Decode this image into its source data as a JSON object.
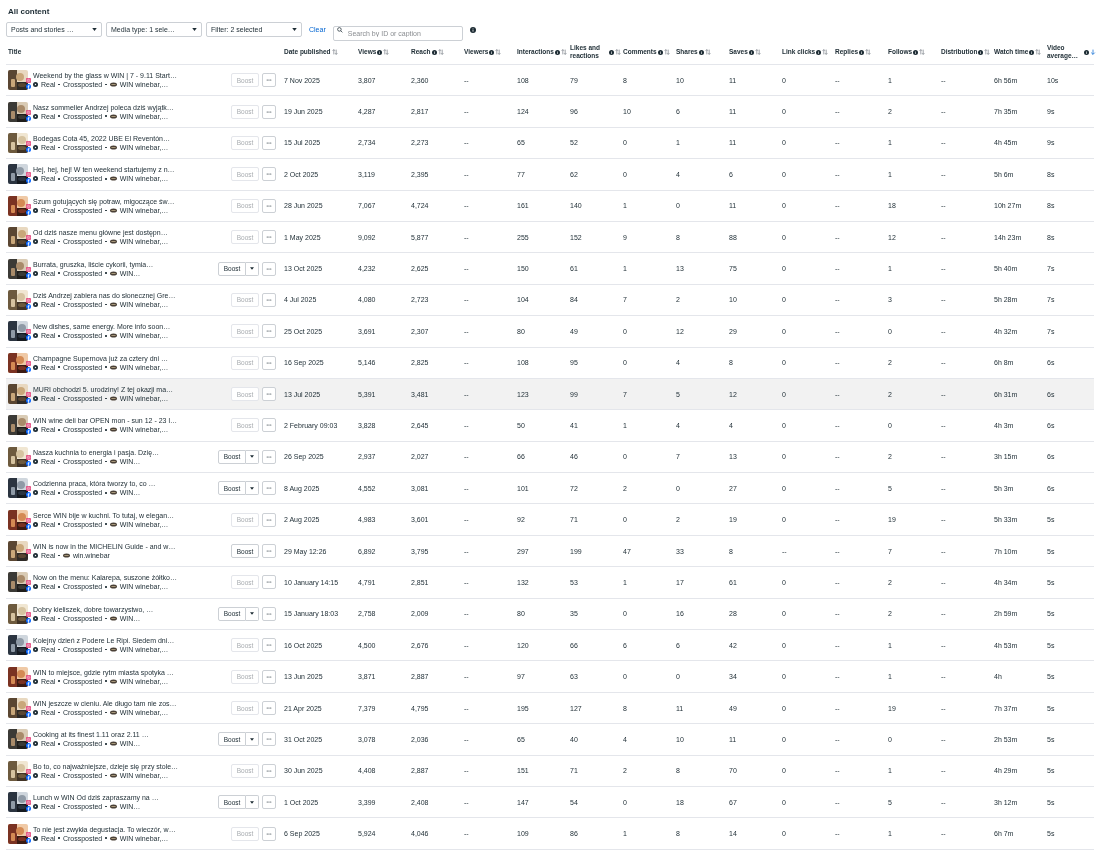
{
  "title": "All content",
  "filters": [
    {
      "label": "Posts and stories …"
    },
    {
      "label": "Media type: 1 sele…"
    },
    {
      "label": "Filter: 2 selected"
    }
  ],
  "clear_link": "Clear",
  "search": {
    "placeholder": "Search by ID or caption"
  },
  "columns": [
    {
      "label": "Title",
      "info": false,
      "sortable": false
    },
    {
      "label": "Date published",
      "info": false,
      "sortable": true,
      "sorted_descending": false
    },
    {
      "label": "Views",
      "info": true,
      "sortable": true,
      "sorted_descending": false
    },
    {
      "label": "Reach",
      "info": true,
      "sortable": true,
      "sorted_descending": false
    },
    {
      "label": "Viewers",
      "info": true,
      "sortable": true,
      "sorted_descending": false
    },
    {
      "label": "Interactions",
      "info": true,
      "sortable": true,
      "sorted_descending": false
    },
    {
      "label": "Likes and reactions",
      "info": true,
      "sortable": true,
      "sorted_descending": false
    },
    {
      "label": "Comments",
      "info": true,
      "sortable": true,
      "sorted_descending": false
    },
    {
      "label": "Shares",
      "info": true,
      "sortable": true,
      "sorted_descending": false
    },
    {
      "label": "Saves",
      "info": true,
      "sortable": true,
      "sorted_descending": false
    },
    {
      "label": "Link clicks",
      "info": true,
      "sortable": true,
      "sorted_descending": false
    },
    {
      "label": "Replies",
      "info": true,
      "sortable": true,
      "sorted_descending": false
    },
    {
      "label": "Follows",
      "info": true,
      "sortable": true,
      "sorted_descending": false
    },
    {
      "label": "Distribution",
      "info": true,
      "sortable": true,
      "sorted_descending": false
    },
    {
      "label": "Watch time",
      "info": true,
      "sortable": true,
      "sorted_descending": false
    },
    {
      "label": "Video average…",
      "info": true,
      "sortable": true,
      "sorted_descending": true
    }
  ],
  "rows": [
    {
      "title": "Weekend by the glass w WIN | 7 - 9.11 Start…",
      "type": "Real",
      "crossposted": "Crossposted",
      "account": "WIN winebar,…",
      "facebook": true,
      "boost_enabled": false,
      "boost_split": false,
      "boost_label": "Boost",
      "selected": false,
      "cells": [
        "7 Nov 2025",
        "3,807",
        "2,360",
        "--",
        "108",
        "79",
        "8",
        "10",
        "11",
        "0",
        "--",
        "1",
        "--",
        "6h 56m",
        "10s"
      ]
    },
    {
      "title": "Nasz sommelier Andrzej poleca dziś wyjątk…",
      "type": "Real",
      "crossposted": "Crossposted",
      "account": "WIN winebar,…",
      "facebook": true,
      "boost_enabled": false,
      "boost_split": false,
      "boost_label": "Boost",
      "selected": false,
      "cells": [
        "19 Jun 2025",
        "4,287",
        "2,817",
        "--",
        "124",
        "96",
        "10",
        "6",
        "11",
        "0",
        "--",
        "2",
        "--",
        "7h 35m",
        "9s"
      ]
    },
    {
      "title": "Bodegas Cota 45, 2022 UBE El Reventón…",
      "type": "Real",
      "crossposted": "Crossposted",
      "account": "WIN winebar,…",
      "facebook": true,
      "boost_enabled": false,
      "boost_split": false,
      "boost_label": "Boost",
      "selected": false,
      "cells": [
        "15 Jul 2025",
        "2,734",
        "2,273",
        "--",
        "65",
        "52",
        "0",
        "1",
        "11",
        "0",
        "--",
        "1",
        "--",
        "4h 45m",
        "9s"
      ]
    },
    {
      "title": "Hej, hej, hej! W ten weekend startujemy z n…",
      "type": "Real",
      "crossposted": "Crossposted",
      "account": "WIN winebar,…",
      "facebook": true,
      "boost_enabled": false,
      "boost_split": false,
      "boost_label": "Boost",
      "selected": false,
      "cells": [
        "2 Oct 2025",
        "3,119",
        "2,395",
        "--",
        "77",
        "62",
        "0",
        "4",
        "6",
        "0",
        "--",
        "1",
        "--",
        "5h 6m",
        "8s"
      ]
    },
    {
      "title": "Szum gotujących się potraw, migoczące św…",
      "type": "Real",
      "crossposted": "Crossposted",
      "account": "WIN winebar,…",
      "facebook": true,
      "boost_enabled": false,
      "boost_split": false,
      "boost_label": "Boost",
      "selected": false,
      "cells": [
        "28 Jun 2025",
        "7,067",
        "4,724",
        "--",
        "161",
        "140",
        "1",
        "0",
        "11",
        "0",
        "--",
        "18",
        "--",
        "10h 27m",
        "8s"
      ]
    },
    {
      "title": "Od dziś nasze menu główne jest dostępn…",
      "type": "Real",
      "crossposted": "Crossposted",
      "account": "WIN winebar,…",
      "facebook": true,
      "boost_enabled": false,
      "boost_split": false,
      "boost_label": "Boost",
      "selected": false,
      "cells": [
        "1 May 2025",
        "9,092",
        "5,877",
        "--",
        "255",
        "152",
        "9",
        "8",
        "88",
        "0",
        "--",
        "12",
        "--",
        "14h 23m",
        "8s"
      ]
    },
    {
      "title": "Burrata, gruszka, liście cykorii, tymia…",
      "type": "Real",
      "crossposted": "Crossposted",
      "account": "WIN…",
      "facebook": true,
      "boost_enabled": true,
      "boost_split": true,
      "boost_label": "Boost",
      "selected": false,
      "cells": [
        "13 Oct 2025",
        "4,232",
        "2,625",
        "--",
        "150",
        "61",
        "1",
        "13",
        "75",
        "0",
        "--",
        "1",
        "--",
        "5h 40m",
        "7s"
      ]
    },
    {
      "title": "Dziś Andrzej zabiera nas do słonecznej Gre…",
      "type": "Real",
      "crossposted": "Crossposted",
      "account": "WIN winebar,…",
      "facebook": true,
      "boost_enabled": false,
      "boost_split": false,
      "boost_label": "Boost",
      "selected": false,
      "cells": [
        "4 Jul 2025",
        "4,080",
        "2,723",
        "--",
        "104",
        "84",
        "7",
        "2",
        "10",
        "0",
        "--",
        "3",
        "--",
        "5h 28m",
        "7s"
      ]
    },
    {
      "title": "New dishes, same energy. More info soon…",
      "type": "Real",
      "crossposted": "Crossposted",
      "account": "WIN winebar,…",
      "facebook": true,
      "boost_enabled": false,
      "boost_split": false,
      "boost_label": "Boost",
      "selected": false,
      "cells": [
        "25 Oct 2025",
        "3,691",
        "2,307",
        "--",
        "80",
        "49",
        "0",
        "12",
        "29",
        "0",
        "--",
        "0",
        "--",
        "4h 32m",
        "7s"
      ]
    },
    {
      "title": "Champagne Supernova już za cztery dni …",
      "type": "Real",
      "crossposted": "Crossposted",
      "account": "WIN winebar,…",
      "facebook": true,
      "boost_enabled": false,
      "boost_split": false,
      "boost_label": "Boost",
      "selected": false,
      "cells": [
        "16 Sep 2025",
        "5,146",
        "2,825",
        "--",
        "108",
        "95",
        "0",
        "4",
        "8",
        "0",
        "--",
        "2",
        "--",
        "6h 8m",
        "6s"
      ]
    },
    {
      "title": "MURI obchodzi 5. urodziny! Z tej okazji ma…",
      "type": "Real",
      "crossposted": "Crossposted",
      "account": "WIN winebar,…",
      "facebook": true,
      "boost_enabled": false,
      "boost_split": false,
      "boost_label": "Boost",
      "selected": true,
      "cells": [
        "13 Jul 2025",
        "5,391",
        "3,481",
        "--",
        "123",
        "99",
        "7",
        "5",
        "12",
        "0",
        "--",
        "2",
        "--",
        "6h 31m",
        "6s"
      ]
    },
    {
      "title": "WIN wine deli bar OPEN mon - sun 12 - 23 l…",
      "type": "Real",
      "crossposted": "Crossposted",
      "account": "WIN winebar,…",
      "facebook": true,
      "boost_enabled": false,
      "boost_split": false,
      "boost_label": "Boost",
      "selected": false,
      "cells": [
        "2 February 09:03",
        "3,828",
        "2,645",
        "--",
        "50",
        "41",
        "1",
        "4",
        "4",
        "0",
        "--",
        "0",
        "--",
        "4h 3m",
        "6s"
      ]
    },
    {
      "title": "Nasza kuchnia to energia i pasja. Dzię…",
      "type": "Real",
      "crossposted": "Crossposted",
      "account": "WIN…",
      "facebook": true,
      "boost_enabled": true,
      "boost_split": true,
      "boost_label": "Boost",
      "selected": false,
      "cells": [
        "26 Sep 2025",
        "2,937",
        "2,027",
        "--",
        "66",
        "46",
        "0",
        "7",
        "13",
        "0",
        "--",
        "2",
        "--",
        "3h 15m",
        "6s"
      ]
    },
    {
      "title": "Codzienna praca, która tworzy to, co …",
      "type": "Real",
      "crossposted": "Crossposted",
      "account": "WIN…",
      "facebook": true,
      "boost_enabled": true,
      "boost_split": true,
      "boost_label": "Boost",
      "selected": false,
      "cells": [
        "8 Aug 2025",
        "4,552",
        "3,081",
        "--",
        "101",
        "72",
        "2",
        "0",
        "27",
        "0",
        "--",
        "5",
        "--",
        "5h 3m",
        "6s"
      ]
    },
    {
      "title": "Serce WIN bije w kuchni. To tutaj, w elegan…",
      "type": "Real",
      "crossposted": "Crossposted",
      "account": "WIN winebar,…",
      "facebook": true,
      "boost_enabled": false,
      "boost_split": false,
      "boost_label": "Boost",
      "selected": false,
      "cells": [
        "2 Aug 2025",
        "4,983",
        "3,601",
        "--",
        "92",
        "71",
        "0",
        "2",
        "19",
        "0",
        "--",
        "19",
        "--",
        "5h 33m",
        "5s"
      ]
    },
    {
      "title": "WIN is now in the MICHELIN Guide - and w…",
      "type": "Real",
      "account": "win.winebar",
      "facebook": false,
      "boost_enabled": true,
      "boost_split": false,
      "boost_label": "Boost",
      "selected": false,
      "cells": [
        "29 May 12:26",
        "6,892",
        "3,795",
        "--",
        "297",
        "199",
        "47",
        "33",
        "8",
        "--",
        "--",
        "7",
        "--",
        "7h 10m",
        "5s"
      ]
    },
    {
      "title": "Now on the menu: Kalarepa, suszone żółtko…",
      "type": "Real",
      "crossposted": "Crossposted",
      "account": "WIN winebar,…",
      "facebook": true,
      "boost_enabled": false,
      "boost_split": false,
      "boost_label": "Boost",
      "selected": false,
      "cells": [
        "10 January 14:15",
        "4,791",
        "2,851",
        "--",
        "132",
        "53",
        "1",
        "17",
        "61",
        "0",
        "--",
        "2",
        "--",
        "4h 34m",
        "5s"
      ]
    },
    {
      "title": "Dobry kieliszek, dobre towarzystwo, …",
      "type": "Real",
      "crossposted": "Crossposted",
      "account": "WIN…",
      "facebook": true,
      "boost_enabled": true,
      "boost_split": true,
      "boost_label": "Boost",
      "selected": false,
      "cells": [
        "15 January 18:03",
        "2,758",
        "2,009",
        "--",
        "80",
        "35",
        "0",
        "16",
        "28",
        "0",
        "--",
        "2",
        "--",
        "2h 59m",
        "5s"
      ]
    },
    {
      "title": "Kolejny dzień z Podere Le Ripi. Siedem dni…",
      "type": "Real",
      "crossposted": "Crossposted",
      "account": "WIN winebar,…",
      "facebook": true,
      "boost_enabled": false,
      "boost_split": false,
      "boost_label": "Boost",
      "selected": false,
      "cells": [
        "16 Oct 2025",
        "4,500",
        "2,676",
        "--",
        "120",
        "66",
        "6",
        "6",
        "42",
        "0",
        "--",
        "1",
        "--",
        "4h 53m",
        "5s"
      ]
    },
    {
      "title": "WIN to miejsce, gdzie rytm miasta spotyka …",
      "type": "Real",
      "crossposted": "Crossposted",
      "account": "WIN winebar,…",
      "facebook": true,
      "boost_enabled": false,
      "boost_split": false,
      "boost_label": "Boost",
      "selected": false,
      "cells": [
        "13 Jun 2025",
        "3,871",
        "2,887",
        "--",
        "97",
        "63",
        "0",
        "0",
        "34",
        "0",
        "--",
        "1",
        "--",
        "4h",
        "5s"
      ]
    },
    {
      "title": "WIN jeszcze w cieniu. Ale długo tam nie zos…",
      "type": "Real",
      "crossposted": "Crossposted",
      "account": "WIN winebar,…",
      "facebook": true,
      "boost_enabled": false,
      "boost_split": false,
      "boost_label": "Boost",
      "selected": false,
      "cells": [
        "21 Apr 2025",
        "7,379",
        "4,795",
        "--",
        "195",
        "127",
        "8",
        "11",
        "49",
        "0",
        "--",
        "19",
        "--",
        "7h 37m",
        "5s"
      ]
    },
    {
      "title": "Cooking at its finest 1.11 oraz 2.11 …",
      "type": "Real",
      "crossposted": "Crossposted",
      "account": "WIN…",
      "facebook": true,
      "boost_enabled": true,
      "boost_split": true,
      "boost_label": "Boost",
      "selected": false,
      "cells": [
        "31 Oct 2025",
        "3,078",
        "2,036",
        "--",
        "65",
        "40",
        "4",
        "10",
        "11",
        "0",
        "--",
        "0",
        "--",
        "2h 53m",
        "5s"
      ]
    },
    {
      "title": "Bo to, co najważniejsze, dzieje się przy stole…",
      "type": "Real",
      "crossposted": "Crossposted",
      "account": "WIN winebar,…",
      "facebook": true,
      "boost_enabled": false,
      "boost_split": false,
      "boost_label": "Boost",
      "selected": false,
      "cells": [
        "30 Jun 2025",
        "4,408",
        "2,887",
        "--",
        "151",
        "71",
        "2",
        "8",
        "70",
        "0",
        "--",
        "1",
        "--",
        "4h 29m",
        "5s"
      ]
    },
    {
      "title": "Lunch w WIN Od dziś zapraszamy na …",
      "type": "Real",
      "crossposted": "Crossposted",
      "account": "WIN…",
      "facebook": true,
      "boost_enabled": true,
      "boost_split": true,
      "boost_label": "Boost",
      "selected": false,
      "cells": [
        "1 Oct 2025",
        "3,399",
        "2,408",
        "--",
        "147",
        "54",
        "0",
        "18",
        "67",
        "0",
        "--",
        "5",
        "--",
        "3h 12m",
        "5s"
      ]
    },
    {
      "title": "To nie jest zwykła degustacja. To wieczór, w…",
      "type": "Real",
      "crossposted": "Crossposted",
      "account": "WIN winebar,…",
      "facebook": true,
      "boost_enabled": false,
      "boost_split": false,
      "boost_label": "Boost",
      "selected": false,
      "cells": [
        "6 Sep 2025",
        "5,924",
        "4,046",
        "--",
        "109",
        "86",
        "1",
        "8",
        "14",
        "0",
        "--",
        "1",
        "--",
        "6h 7m",
        "5s"
      ]
    }
  ]
}
